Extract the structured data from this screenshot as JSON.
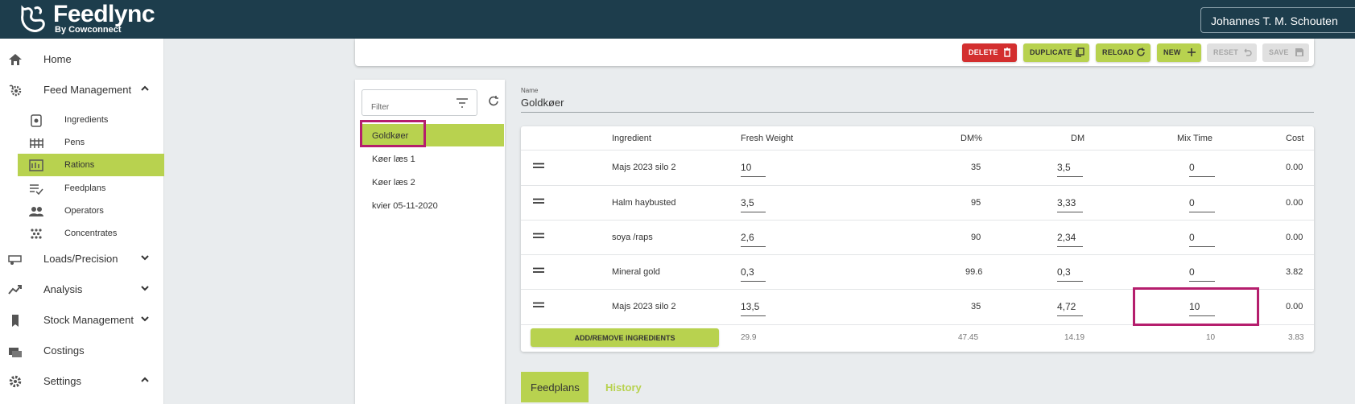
{
  "brand": {
    "title": "Feedlync",
    "subtitle": "By Cowconnect"
  },
  "user": {
    "name": "Johannes T. M. Schouten"
  },
  "sidebar": {
    "items": [
      {
        "label": "Home",
        "icon": "home-icon"
      },
      {
        "label": "Feed Management",
        "icon": "gear-leaf-icon",
        "expanded": true
      },
      {
        "label": "Loads/Precision",
        "icon": "wagon-icon"
      },
      {
        "label": "Analysis",
        "icon": "trend-icon"
      },
      {
        "label": "Stock Management",
        "icon": "silo-icon"
      },
      {
        "label": "Costings",
        "icon": "money-icon"
      },
      {
        "label": "Settings",
        "icon": "gear-icon",
        "expanded": true
      }
    ],
    "feed_sub": [
      {
        "label": "Ingredients",
        "icon": "sack-icon"
      },
      {
        "label": "Pens",
        "icon": "pen-icon"
      },
      {
        "label": "Rations",
        "icon": "ration-icon",
        "active": true
      },
      {
        "label": "Feedplans",
        "icon": "list-check-icon"
      },
      {
        "label": "Operators",
        "icon": "people-icon"
      },
      {
        "label": "Concentrates",
        "icon": "dots-icon"
      }
    ]
  },
  "toolbar": {
    "delete": "DELETE",
    "duplicate": "DUPLICATE",
    "reload": "RELOAD",
    "new": "NEW",
    "reset": "RESET",
    "save": "SAVE"
  },
  "rations": {
    "filter_placeholder": "Filter",
    "items": [
      "Goldkøer",
      "Køer læs 1",
      "Køer læs 2",
      "kvier 05-11-2020"
    ]
  },
  "ration": {
    "name_label": "Name",
    "name": "Goldkøer"
  },
  "table": {
    "headers": [
      "Ingredient",
      "Fresh Weight",
      "DM%",
      "DM",
      "Mix Time",
      "Cost"
    ],
    "rows": [
      {
        "ingredient": "Majs 2023 silo 2",
        "fresh_weight": "10",
        "dm_pct": "35",
        "dm": "3,5",
        "mix_time": "0",
        "cost": "0.00"
      },
      {
        "ingredient": "Halm haybusted",
        "fresh_weight": "3,5",
        "dm_pct": "95",
        "dm": "3,33",
        "mix_time": "0",
        "cost": "0.00"
      },
      {
        "ingredient": "soya /raps",
        "fresh_weight": "2,6",
        "dm_pct": "90",
        "dm": "2,34",
        "mix_time": "0",
        "cost": "0.00"
      },
      {
        "ingredient": "Mineral gold",
        "fresh_weight": "0,3",
        "dm_pct": "99.6",
        "dm": "0,3",
        "mix_time": "0",
        "cost": "3.82"
      },
      {
        "ingredient": "Majs 2023 silo 2",
        "fresh_weight": "13,5",
        "dm_pct": "35",
        "dm": "4,72",
        "mix_time": "10",
        "cost": "0.00"
      }
    ],
    "add_button": "ADD/REMOVE INGREDIENTS",
    "totals": {
      "fresh_weight": "29.9",
      "dm_pct": "47.45",
      "dm": "14.19",
      "mix_time": "10",
      "cost": "3.83"
    }
  },
  "tabs": {
    "feedplans": "Feedplans",
    "history": "History"
  },
  "colors": {
    "header": "#1d3d4c",
    "accent": "#b8d24f",
    "danger": "#d32f2f",
    "highlight": "#b51e6d"
  }
}
